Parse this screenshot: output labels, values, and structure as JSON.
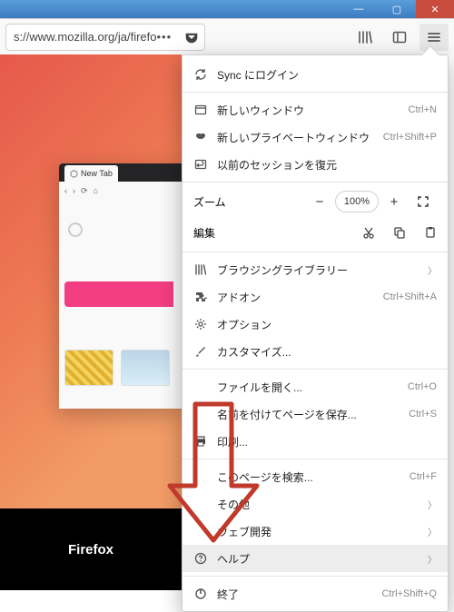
{
  "window": {
    "btn_min": "—",
    "btn_max": "▢",
    "btn_close": "✕"
  },
  "urlbar": {
    "url": "s://www.mozilla.org/ja/firefo",
    "dots": "•••"
  },
  "inset": {
    "tab_label": "New Tab"
  },
  "content": {
    "brand": "Firefox"
  },
  "menu": {
    "sync": "Sync にログイン",
    "new_window": "新しいウィンドウ",
    "new_window_sc": "Ctrl+N",
    "new_private": "新しいプライベートウィンドウ",
    "new_private_sc": "Ctrl+Shift+P",
    "restore": "以前のセッションを復元",
    "zoom_label": "ズーム",
    "zoom_value": "100%",
    "edit_label": "編集",
    "library": "ブラウジングライブラリー",
    "addons": "アドオン",
    "addons_sc": "Ctrl+Shift+A",
    "options": "オプション",
    "customize": "カスタマイズ...",
    "open_file": "ファイルを開く...",
    "open_file_sc": "Ctrl+O",
    "save_as": "名前を付けてページを保存...",
    "save_as_sc": "Ctrl+S",
    "print": "印刷...",
    "find": "このページを検索...",
    "find_sc": "Ctrl+F",
    "more": "その他",
    "webdev": "ウェブ開発",
    "help": "ヘルプ",
    "quit": "終了",
    "quit_sc": "Ctrl+Shift+Q"
  }
}
